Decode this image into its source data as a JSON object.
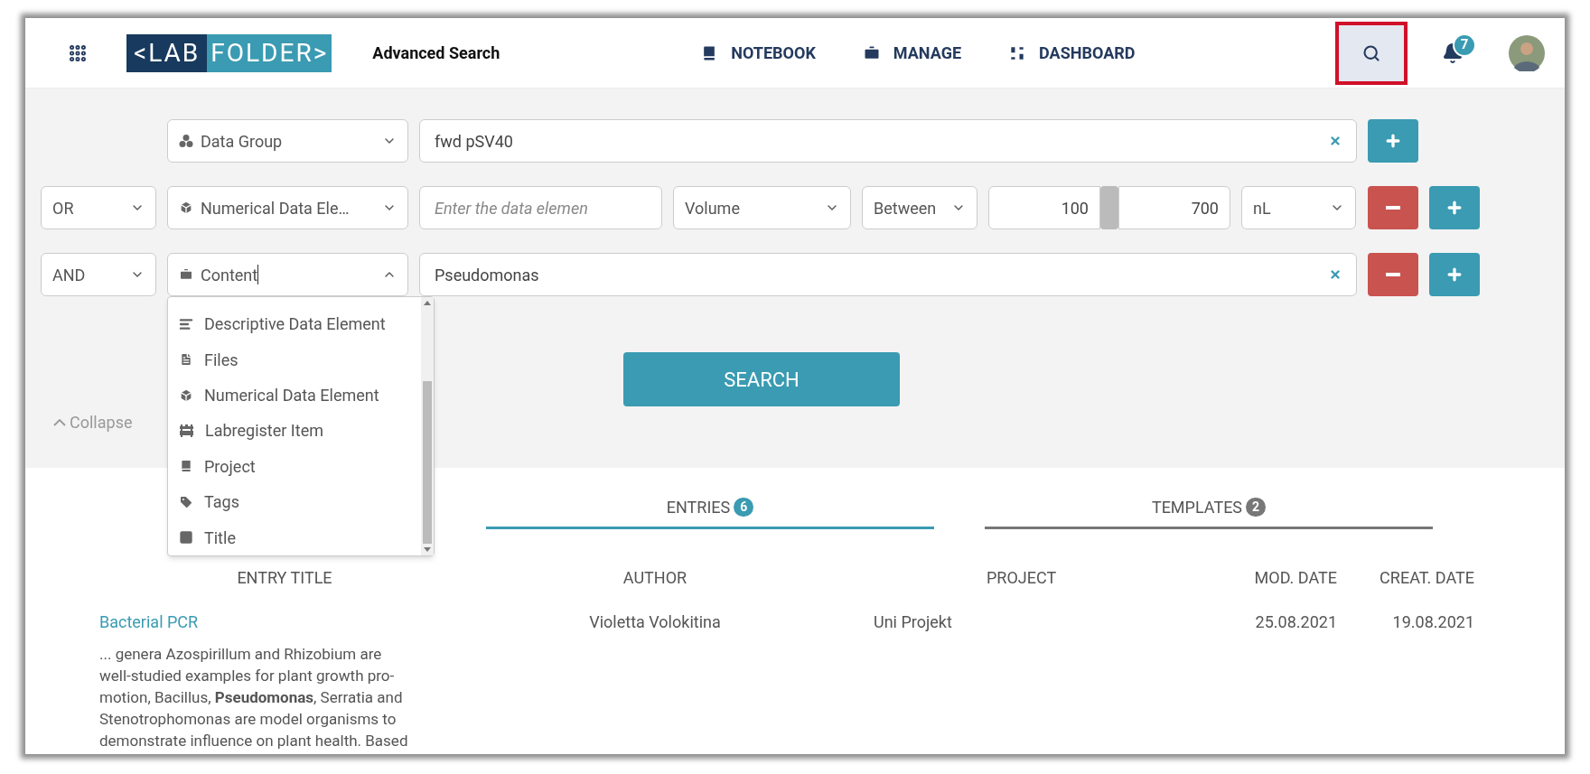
{
  "header": {
    "logo": {
      "left": "<LAB",
      "right": "FOLDER>"
    },
    "page_title": "Advanced Search",
    "nav": [
      {
        "kind": "notebook",
        "label": "NOTEBOOK"
      },
      {
        "kind": "manage",
        "label": "MANAGE"
      },
      {
        "kind": "dashboard",
        "label": "DASHBOARD"
      }
    ],
    "search_button": {
      "highlighted": true
    },
    "notifications": {
      "count": "7"
    }
  },
  "query_rows": [
    {
      "kind": "text",
      "field": {
        "kind": "data_group",
        "label": "Data Group",
        "expanded": false
      },
      "value": "fwd pSV40",
      "removable": false
    },
    {
      "kind": "numeric",
      "operator": "OR",
      "field": {
        "kind": "numerical",
        "label": "Numerical Data Ele…",
        "expanded": false
      },
      "placeholder": "Enter the data elemen",
      "quantity": "Volume",
      "comparison": "Between",
      "min": "100",
      "max": "700",
      "unit": "nL",
      "removable": true
    },
    {
      "kind": "text",
      "operator": "AND",
      "field": {
        "kind": "content",
        "label": "Content",
        "expanded": true
      },
      "value": "Pseudomonas",
      "removable": true
    }
  ],
  "field_dropdown": {
    "options": [
      {
        "kind": "descriptive",
        "label": "Descriptive Data Element"
      },
      {
        "kind": "files",
        "label": "Files"
      },
      {
        "kind": "numerical",
        "label": "Numerical Data Element"
      },
      {
        "kind": "labregister",
        "label": "Labregister Item"
      },
      {
        "kind": "project",
        "label": "Project"
      },
      {
        "kind": "tags",
        "label": "Tags"
      },
      {
        "kind": "title",
        "label": "Title"
      }
    ]
  },
  "search_action": "SEARCH",
  "collapse": "Collapse",
  "tabs": [
    {
      "label": "ENTRIES",
      "count": "6",
      "selected": true
    },
    {
      "label": "TEMPLATES",
      "count": "2",
      "selected": false
    }
  ],
  "table": {
    "columns": [
      "ENTRY TITLE",
      "AUTHOR",
      "PROJECT",
      "MOD. DATE",
      "CREAT. DATE"
    ],
    "rows": [
      {
        "title": "Bacterial PCR",
        "snippet": "... genera Azospirillum and Rhizobium are well-studied examples for plant growth pro-motion, Bacillus, **Pseudomonas**, Serratia and Stenotrophomonas are model organisms to demonstrate influence on plant health. Based",
        "author": "Violetta Volokitina",
        "project": "Uni Projekt",
        "mod_date": "25.08.2021",
        "creat_date": "19.08.2021"
      }
    ]
  }
}
